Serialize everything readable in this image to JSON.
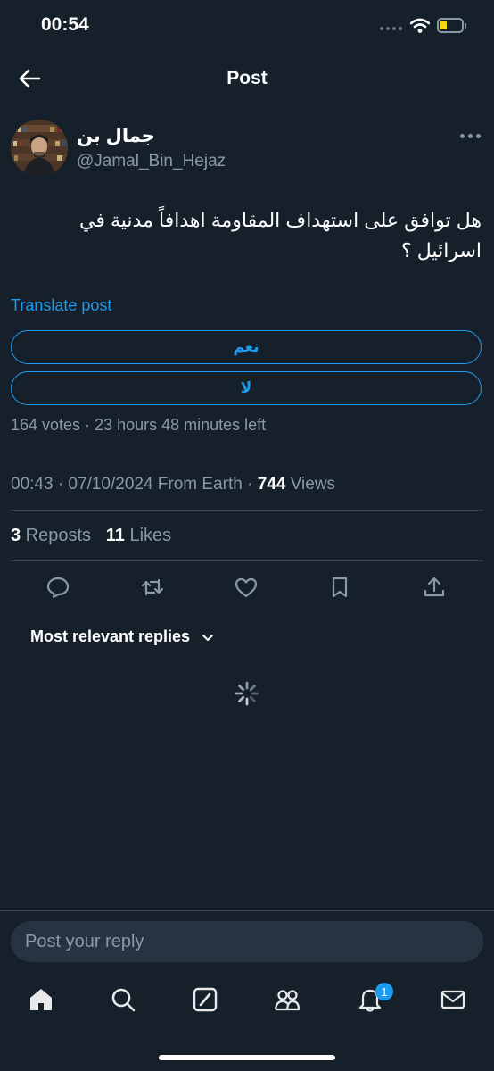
{
  "status_bar": {
    "time": "00:54"
  },
  "header": {
    "title": "Post"
  },
  "post": {
    "author_name": "جمال بن",
    "author_handle": "@Jamal_Bin_Hejaz",
    "text": "هل توافق على استهداف المقاومة اهدافاً مدنية في اسرائيل ؟",
    "translate_label": "Translate post",
    "poll": {
      "options": [
        "نعم",
        "لا"
      ],
      "meta": "164 votes · 23 hours 48 minutes left"
    },
    "timestamp": "00:43 · 07/10/2024 From Earth · ",
    "views_count": "744",
    "views_label": " Views",
    "reposts_count": "3",
    "reposts_label": " Reposts",
    "likes_count": "11",
    "likes_label": " Likes"
  },
  "replies": {
    "sort_label": "Most relevant replies"
  },
  "compose": {
    "placeholder": "Post your reply"
  },
  "nav": {
    "notifications_badge": "1"
  },
  "colors": {
    "background": "#15202b",
    "accent": "#1d9bf0",
    "muted": "#8b98a5",
    "divider": "#38444d"
  },
  "icons": [
    "back-arrow-icon",
    "more-icon",
    "reply-icon",
    "repost-icon",
    "like-icon",
    "bookmark-icon",
    "share-icon",
    "chevron-down-icon",
    "home-icon",
    "search-icon",
    "grok-icon",
    "communities-icon",
    "notifications-icon",
    "messages-icon"
  ]
}
